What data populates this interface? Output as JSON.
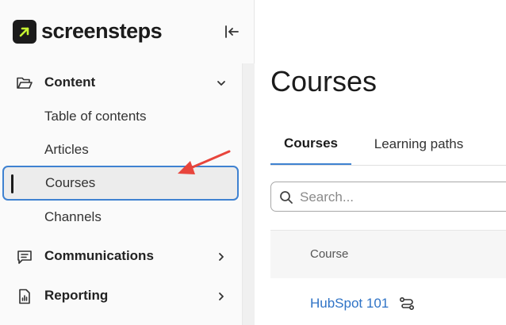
{
  "brand": {
    "name": "screensteps",
    "accent": "#c6f432",
    "mark_bg": "#1b1b1b"
  },
  "sidebar": {
    "collapse_icon": "collapse-left-icon",
    "sections": [
      {
        "label": "Content",
        "icon": "folder-open-icon",
        "expanded": true,
        "items": [
          {
            "label": "Table of contents"
          },
          {
            "label": "Articles"
          },
          {
            "label": "Courses",
            "active": true
          },
          {
            "label": "Channels"
          }
        ]
      },
      {
        "label": "Communications",
        "icon": "message-square-icon",
        "expanded": false
      },
      {
        "label": "Reporting",
        "icon": "report-document-icon",
        "expanded": false
      }
    ]
  },
  "main": {
    "title": "Courses",
    "tabs": [
      {
        "label": "Courses",
        "active": true
      },
      {
        "label": "Learning paths",
        "active": false
      }
    ],
    "search": {
      "placeholder": "Search..."
    },
    "table": {
      "columns": [
        "Course"
      ],
      "rows": [
        {
          "course": "HubSpot 101",
          "icon": "learning-path-icon"
        }
      ]
    }
  },
  "colors": {
    "active_border": "#3f82d1",
    "link": "#2f73c6",
    "annotation": "#e8453c"
  }
}
